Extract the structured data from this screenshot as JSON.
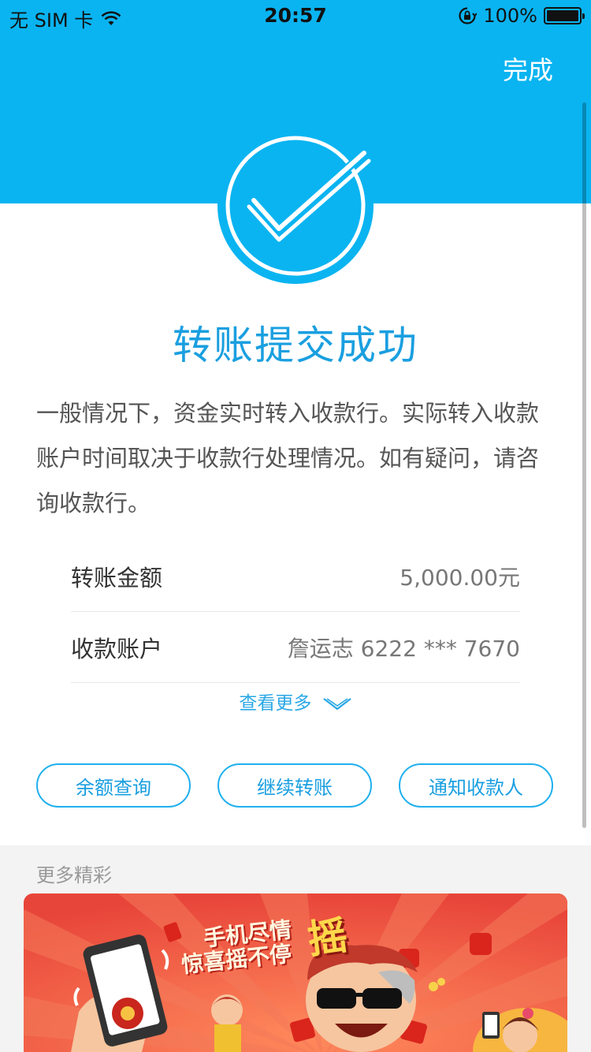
{
  "status_bar": {
    "carrier": "无 SIM 卡",
    "time": "20:57",
    "battery_percent": "100%"
  },
  "header": {
    "done_label": "完成"
  },
  "result": {
    "title": "转账提交成功",
    "description": "一般情况下，资金实时转入收款行。实际转入收款账户时间取决于收款行处理情况。如有疑问，请咨询收款行。"
  },
  "details": [
    {
      "label": "转账金额",
      "value": "5,000.00元"
    },
    {
      "label": "收款账户",
      "value": "詹运志 6222 *** 7670"
    }
  ],
  "view_more_label": "查看更多",
  "actions": [
    {
      "label": "余额查询"
    },
    {
      "label": "继续转账"
    },
    {
      "label": "通知收款人"
    }
  ],
  "more": {
    "section_title": "更多精彩",
    "banner": {
      "line1": "手机尽情",
      "line2": "惊喜摇不停",
      "highlight": "摇"
    }
  },
  "colors": {
    "primary": "#0ab4f1",
    "title_blue": "#1a9fe0",
    "banner_red": "#f06048"
  }
}
